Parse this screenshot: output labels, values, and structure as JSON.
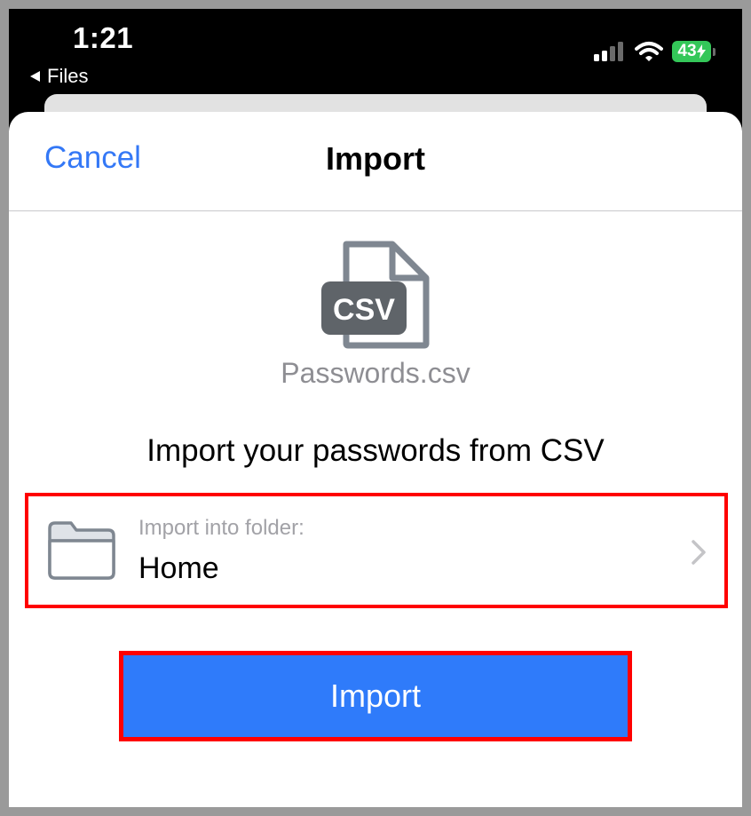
{
  "status_bar": {
    "time": "1:21",
    "back_label": "Files",
    "battery_level": "43",
    "icons": [
      "signal-icon",
      "wifi-icon",
      "battery-charging-icon"
    ]
  },
  "nav": {
    "cancel_label": "Cancel",
    "title": "Import"
  },
  "file": {
    "icon": "csv-file-icon",
    "badge": "CSV",
    "name": "Passwords.csv"
  },
  "description": "Import your passwords from CSV",
  "folder_picker": {
    "icon": "folder-icon",
    "label": "Import into folder:",
    "value": "Home"
  },
  "import_button_label": "Import",
  "colors": {
    "accent": "#3478f6",
    "button_bg": "#2f7bfa",
    "battery": "#34c759",
    "highlight": "#ff0000"
  }
}
